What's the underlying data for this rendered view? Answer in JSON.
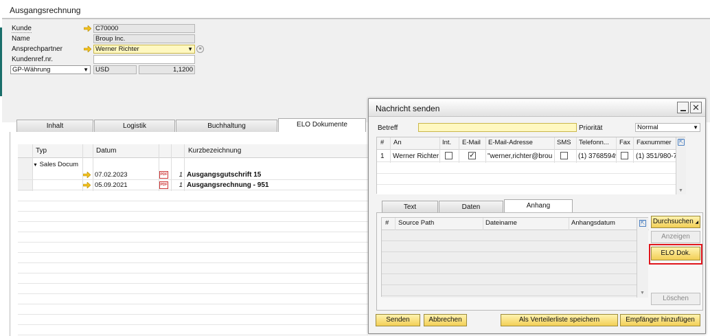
{
  "window": {
    "title": "Ausgangsrechnung"
  },
  "form": {
    "kunde_label": "Kunde",
    "kunde_value": "C70000",
    "name_label": "Name",
    "name_value": "Broup Inc.",
    "ansprech_label": "Ansprechpartner",
    "ansprech_value": "Werner Richter",
    "kundenref_label": "Kundenref.nr.",
    "kundenref_value": "",
    "currency_select": "GP-Währung",
    "currency_value": "USD",
    "rate_value": "1,1200"
  },
  "tabs": {
    "t1": "Inhalt",
    "t2": "Logistik",
    "t3": "Buchhaltung",
    "t4": "ELO Dokumente"
  },
  "elo_table": {
    "headers": {
      "typ": "Typ",
      "datum": "Datum",
      "kurz": "Kurzbezeichnung"
    },
    "group": "Sales Docum",
    "rows": [
      {
        "datum": "07.02.2023",
        "num": "1",
        "kurz": "Ausgangsgutschrift 15"
      },
      {
        "datum": "05.09.2021",
        "num": "1",
        "kurz": "Ausgangsrechnung - 951"
      }
    ]
  },
  "dialog": {
    "title": "Nachricht senden",
    "betreff_label": "Betreff",
    "prioritaet_label": "Priorität",
    "prioritaet_value": "Normal",
    "recip_headers": {
      "num": "#",
      "an": "An",
      "int": "Int.",
      "email": "E-Mail",
      "addr": "E-Mail-Adresse",
      "sms": "SMS",
      "tel": "Telefonn...",
      "fax": "Fax",
      "faxnr": "Faxnummer"
    },
    "recip_row": {
      "num": "1",
      "an": "Werner Richter",
      "addr": "\"werner,richter@brou",
      "tel": "(1) 37685949",
      "faxnr": "(1) 351/980-7"
    },
    "tabs": {
      "text": "Text",
      "daten": "Daten",
      "anhang": "Anhang"
    },
    "attach_headers": {
      "num": "#",
      "path": "Source Path",
      "datei": "Dateiname",
      "datum": "Anhangsdatum"
    },
    "buttons": {
      "durchsuchen": "Durchsuchen",
      "anzeigen": "Anzeigen",
      "elo": "ELO Dok.",
      "loeschen": "Löschen",
      "senden": "Senden",
      "abbrechen": "Abbrechen",
      "verteiler": "Als Verteilerliste speichern",
      "empfaenger": "Empfänger hinzufügen"
    }
  },
  "colors": {
    "accent": "#f2cf56",
    "highlight_border": "#e0161c",
    "field_yellow": "#fff8c0"
  }
}
